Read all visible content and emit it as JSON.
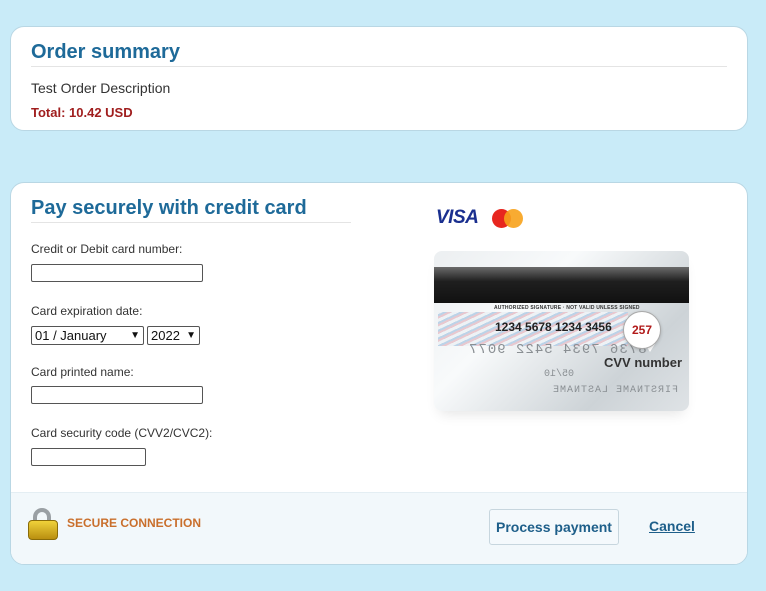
{
  "order_summary": {
    "title": "Order summary",
    "description": "Test Order Description",
    "total": "Total: 10.42 USD"
  },
  "payment": {
    "title": "Pay securely with credit card",
    "card_number_label": "Credit or Debit card number:",
    "card_number_value": "",
    "expiration_label": "Card expiration date:",
    "expiration_month": "01 / January",
    "expiration_year": "2022",
    "printed_name_label": "Card printed name:",
    "printed_name_value": "",
    "cvv_label": "Card security code (CVV2/CVC2):",
    "cvv_value": ""
  },
  "brands": {
    "visa": "VISA",
    "mastercard_icon": "mastercard-logo-icon",
    "colors": {
      "visa": "#1a2f8f",
      "mc_red": "#e7261f",
      "mc_orange": "#f7a21b"
    }
  },
  "card_illustration": {
    "authorized": "AUTHORIZED SIGNATURE · NOT VALID UNLESS SIGNED",
    "card_number": "1234 5678 1234 3456",
    "cvv": "257",
    "cvv_caption": "CVV number",
    "embossed_number": "8736 7934 5422 9077",
    "embossed_expiry": "05/10",
    "embossed_name": "FIRSTNAME LASTNAME"
  },
  "footer": {
    "lock_icon": "padlock-icon",
    "secure_text": "SECURE CONNECTION",
    "process_button": "Process payment",
    "cancel_link": "Cancel"
  },
  "colors": {
    "background": "#c9ebf8",
    "heading": "#1e6a99",
    "total": "#a01e1e",
    "secure": "#c96f2c",
    "button_text": "#1e5f8a"
  }
}
